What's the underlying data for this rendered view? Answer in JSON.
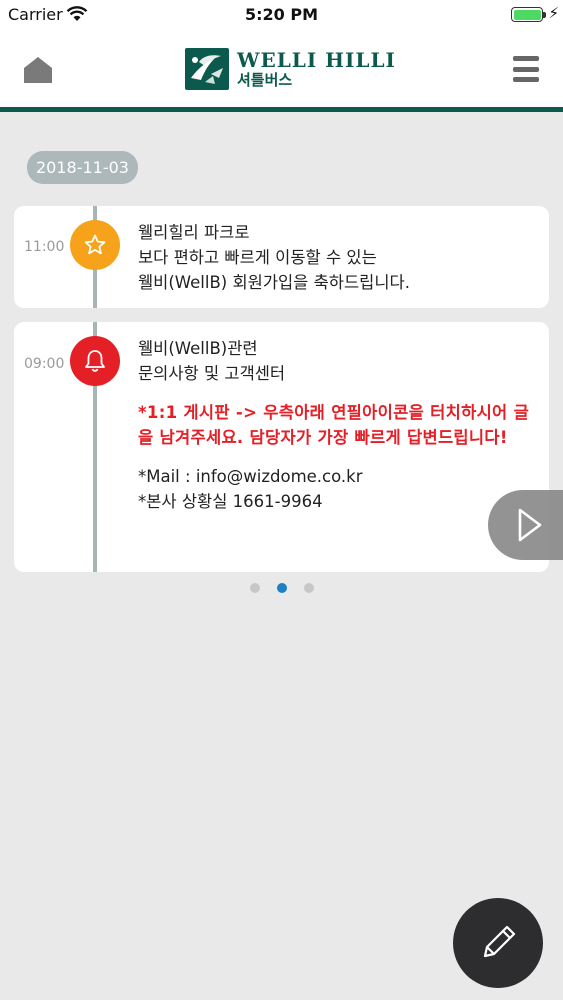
{
  "status_bar": {
    "carrier": "Carrier",
    "time": "5:20 PM",
    "battery_level": 1.0,
    "wifi_icon": "wifi-icon",
    "battery_icon": "battery-icon",
    "charging_icon": "bolt-icon"
  },
  "header": {
    "logo_title": "WELLI HILLI",
    "logo_subtitle": "셔틀버스",
    "home_icon": "home-icon",
    "menu_icon": "hamburger-menu-icon",
    "brand_color": "#0c5a4e"
  },
  "date_label": "2018-11-03",
  "messages": [
    {
      "time": "11:00",
      "icon": "star-icon",
      "icon_color": "#f6a21a",
      "lines": [
        "웰리힐리 파크로",
        "보다 편하고 빠르게 이동할 수 있는",
        "웰비(WellB) 회원가입을 축하드립니다."
      ]
    },
    {
      "time": "09:00",
      "icon": "bell-icon",
      "icon_color": "#e41f26",
      "lines": [
        "웰비(WellB)관련",
        "문의사항 및 고객센터"
      ],
      "notice": "*1:1 게시판 -> 우측아래 연필아이콘을 터치하시어 글을 남겨주세요. 담당자가 가장 빠르게 답변드립니다!",
      "contacts": [
        "*Mail : info@wizdome.co.kr",
        "*본사 상황실 1661-9964"
      ]
    }
  ],
  "pager": {
    "total": 3,
    "current": 2
  },
  "next_icon": "chevron-right-icon",
  "fab_icon": "pencil-icon",
  "colors": {
    "accent_blue": "#1e7fc3",
    "notice_red": "#e41f26",
    "timeline": "#a9b4b6"
  }
}
